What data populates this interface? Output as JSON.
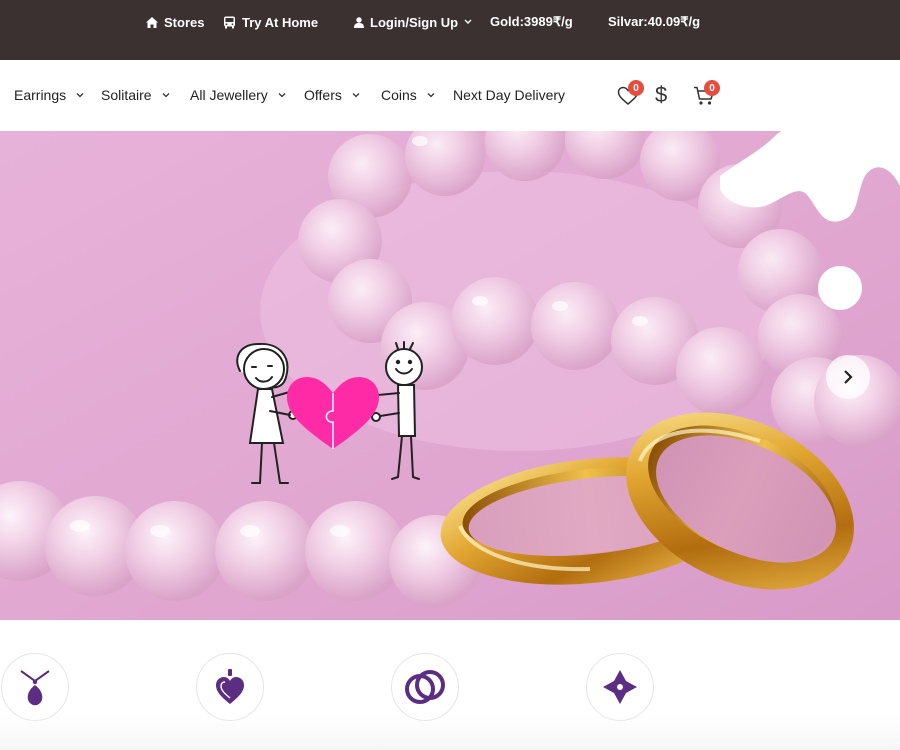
{
  "topbar": {
    "stores_label": "Stores",
    "try_at_home_label": "Try At Home",
    "login_label": "Login/Sign Up",
    "gold_rate": "Gold:3989₹/g",
    "silver_rate": "Silvar:40.09₹/g"
  },
  "nav": {
    "items": [
      {
        "label": "Earrings"
      },
      {
        "label": "Solitaire"
      },
      {
        "label": "All Jewellery"
      },
      {
        "label": "Offers"
      },
      {
        "label": "Coins"
      },
      {
        "label": "Next Day Delivery"
      }
    ],
    "wishlist_count": "0",
    "cart_count": "0",
    "currency_symbol": "$"
  },
  "hero": {
    "background_color": "#e3a9d4",
    "accent_heart_color": "#ff2aa5"
  },
  "categories": [
    {
      "icon": "pendant-icon"
    },
    {
      "icon": "heart-pendant-icon"
    },
    {
      "icon": "rings-icon"
    },
    {
      "icon": "diamond-icon"
    }
  ],
  "colors": {
    "topbar_bg": "#3b3131",
    "badge": "#e74c3c",
    "category_icon": "#5b2d83"
  }
}
